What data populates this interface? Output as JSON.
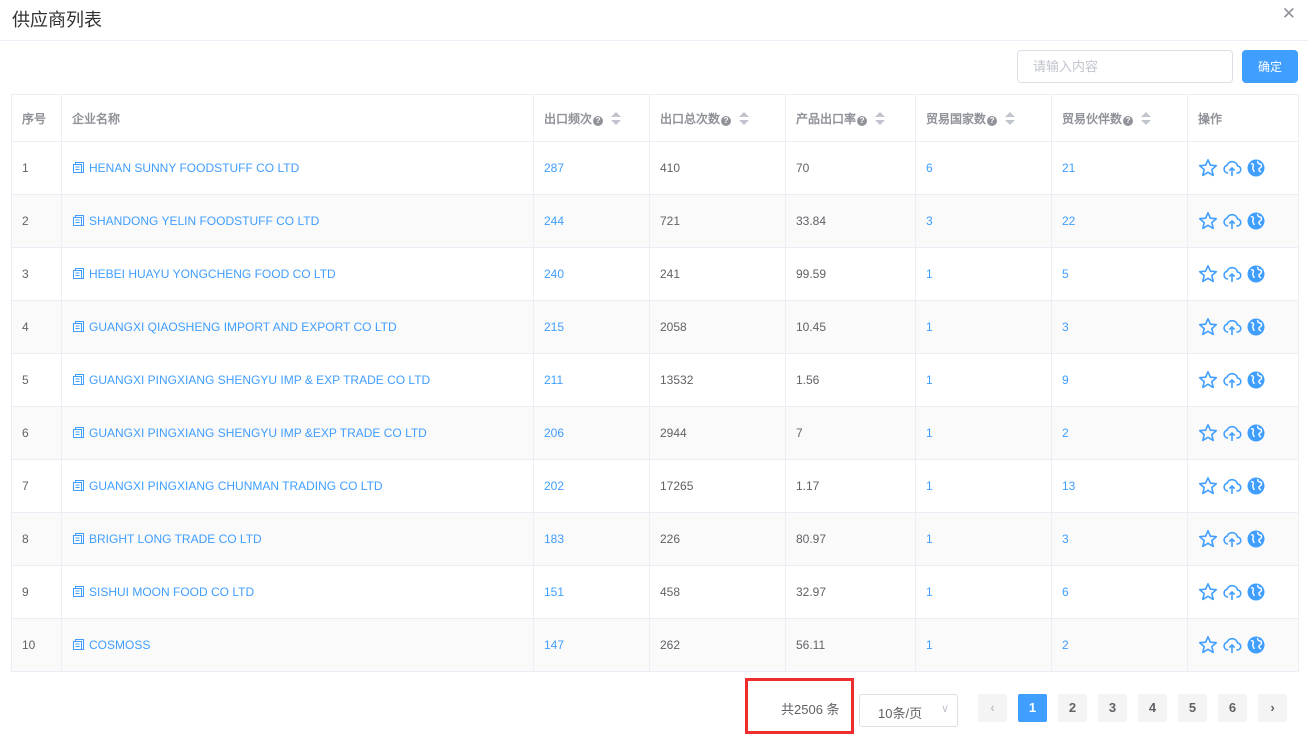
{
  "dialog": {
    "title": "供应商列表"
  },
  "search": {
    "placeholder": "请输入内容",
    "confirm_label": "确定"
  },
  "table": {
    "headers": {
      "index": "序号",
      "company": "企业名称",
      "export_freq": "出口频次",
      "export_total": "出口总次数",
      "export_rate": "产品出口率",
      "countries": "贸易国家数",
      "partners": "贸易伙伴数",
      "ops": "操作"
    },
    "rows": [
      {
        "index": "1",
        "company": "HENAN SUNNY FOODSTUFF CO LTD",
        "export_freq": "287",
        "export_total": "410",
        "export_rate": "70",
        "countries": "6",
        "partners": "21"
      },
      {
        "index": "2",
        "company": "SHANDONG YELIN FOODSTUFF CO LTD",
        "export_freq": "244",
        "export_total": "721",
        "export_rate": "33.84",
        "countries": "3",
        "partners": "22"
      },
      {
        "index": "3",
        "company": "HEBEI HUAYU YONGCHENG FOOD CO LTD",
        "export_freq": "240",
        "export_total": "241",
        "export_rate": "99.59",
        "countries": "1",
        "partners": "5"
      },
      {
        "index": "4",
        "company": "GUANGXI QIAOSHENG IMPORT AND EXPORT CO LTD",
        "export_freq": "215",
        "export_total": "2058",
        "export_rate": "10.45",
        "countries": "1",
        "partners": "3"
      },
      {
        "index": "5",
        "company": "GUANGXI PINGXIANG SHENGYU IMP & EXP TRADE CO LTD",
        "export_freq": "211",
        "export_total": "13532",
        "export_rate": "1.56",
        "countries": "1",
        "partners": "9"
      },
      {
        "index": "6",
        "company": "GUANGXI PINGXIANG SHENGYU IMP &EXP TRADE CO LTD",
        "export_freq": "206",
        "export_total": "2944",
        "export_rate": "7",
        "countries": "1",
        "partners": "2"
      },
      {
        "index": "7",
        "company": "GUANGXI PINGXIANG CHUNMAN TRADING CO LTD",
        "export_freq": "202",
        "export_total": "17265",
        "export_rate": "1.17",
        "countries": "1",
        "partners": "13"
      },
      {
        "index": "8",
        "company": "BRIGHT LONG TRADE CO LTD",
        "export_freq": "183",
        "export_total": "226",
        "export_rate": "80.97",
        "countries": "1",
        "partners": "3"
      },
      {
        "index": "9",
        "company": "SISHUI MOON FOOD CO LTD",
        "export_freq": "151",
        "export_total": "458",
        "export_rate": "32.97",
        "countries": "1",
        "partners": "6"
      },
      {
        "index": "10",
        "company": "COSMOSS",
        "export_freq": "147",
        "export_total": "262",
        "export_rate": "56.11",
        "countries": "1",
        "partners": "2"
      }
    ]
  },
  "pagination": {
    "total_text": "共2506 条",
    "page_size": "10条/页",
    "pages": [
      "1",
      "2",
      "3",
      "4",
      "5",
      "6"
    ],
    "current_page": "1"
  },
  "colors": {
    "accent": "#409eff",
    "highlight": "#ee2e2e"
  },
  "icons": [
    "close-icon",
    "document-icon",
    "help-icon",
    "sort-icon",
    "star-icon",
    "cloud-upload-icon",
    "globe-icon",
    "chevron-left-icon",
    "chevron-right-icon",
    "chevron-down-icon"
  ]
}
